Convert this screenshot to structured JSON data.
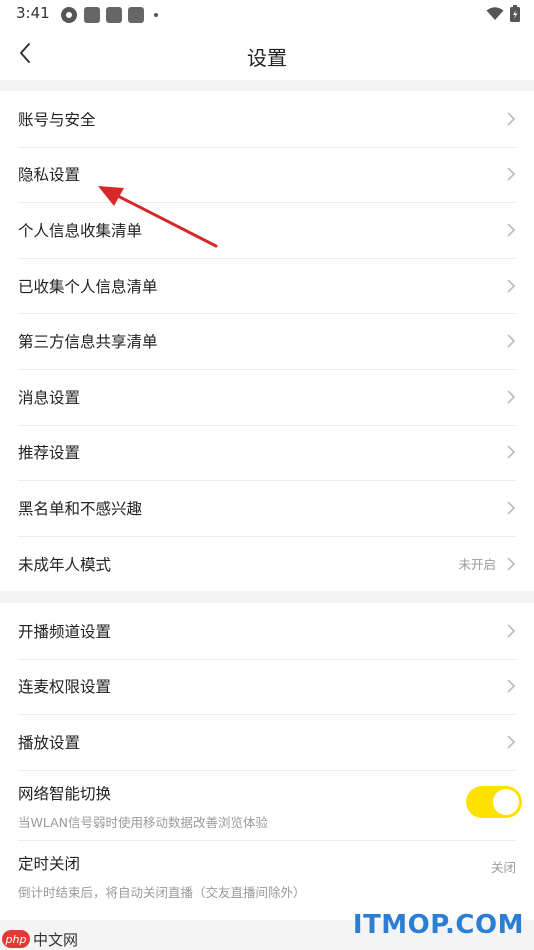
{
  "status_bar": {
    "time": "3:41"
  },
  "header": {
    "title": "设置"
  },
  "group1": [
    {
      "label": "账号与安全"
    },
    {
      "label": "隐私设置"
    },
    {
      "label": "个人信息收集清单"
    },
    {
      "label": "已收集个人信息清单"
    },
    {
      "label": "第三方信息共享清单"
    },
    {
      "label": "消息设置"
    },
    {
      "label": "推荐设置"
    },
    {
      "label": "黑名单和不感兴趣"
    },
    {
      "label": "未成年人模式",
      "value": "未开启"
    }
  ],
  "group2": [
    {
      "label": "开播频道设置"
    },
    {
      "label": "连麦权限设置"
    },
    {
      "label": "播放设置"
    }
  ],
  "network_switch": {
    "label": "网络智能切换",
    "sub": "当WLAN信号弱时使用移动数据改善浏览体验",
    "enabled": true
  },
  "timer_close": {
    "label": "定时关闭",
    "value": "关闭",
    "sub": "倒计时结束后，将自动关闭直播（交友直播间除外）"
  },
  "watermarks": {
    "left_badge": "php",
    "left_text": "中文网",
    "right_text": "ITMOP.COM"
  },
  "colors": {
    "toggle_on": "#ffe100",
    "annotation_arrow": "#d62828"
  }
}
